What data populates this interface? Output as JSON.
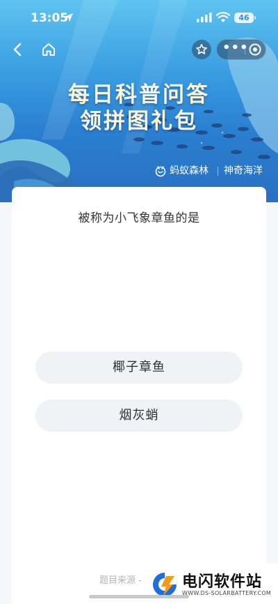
{
  "status_bar": {
    "time": "13:05",
    "battery": "46"
  },
  "nav": {
    "back_icon": "chevron-left-icon",
    "home_icon": "home-icon",
    "favorite_icon": "star-icon",
    "more_icon": "more-dots-icon",
    "more_label": "•••",
    "close_icon": "target-close-icon"
  },
  "banner": {
    "title_line1": "每日科普问答",
    "title_line2": "领拼图礼包",
    "brand_ant": "蚂蚁森林",
    "brand_ocean": "神奇海洋",
    "colors": {
      "sky_top": "#5fc4f0",
      "sea_deep": "#2a6fc2",
      "title": "#fff8d8"
    }
  },
  "quiz": {
    "question": "被称为小飞象章鱼的是",
    "options": [
      {
        "label": "椰子章鱼"
      },
      {
        "label": "烟灰蛸"
      }
    ],
    "source_text": "题目来源 -"
  },
  "watermark": {
    "name": "电闪软件站",
    "url": "WWW.DS-SOLARBATTERY.COM"
  }
}
